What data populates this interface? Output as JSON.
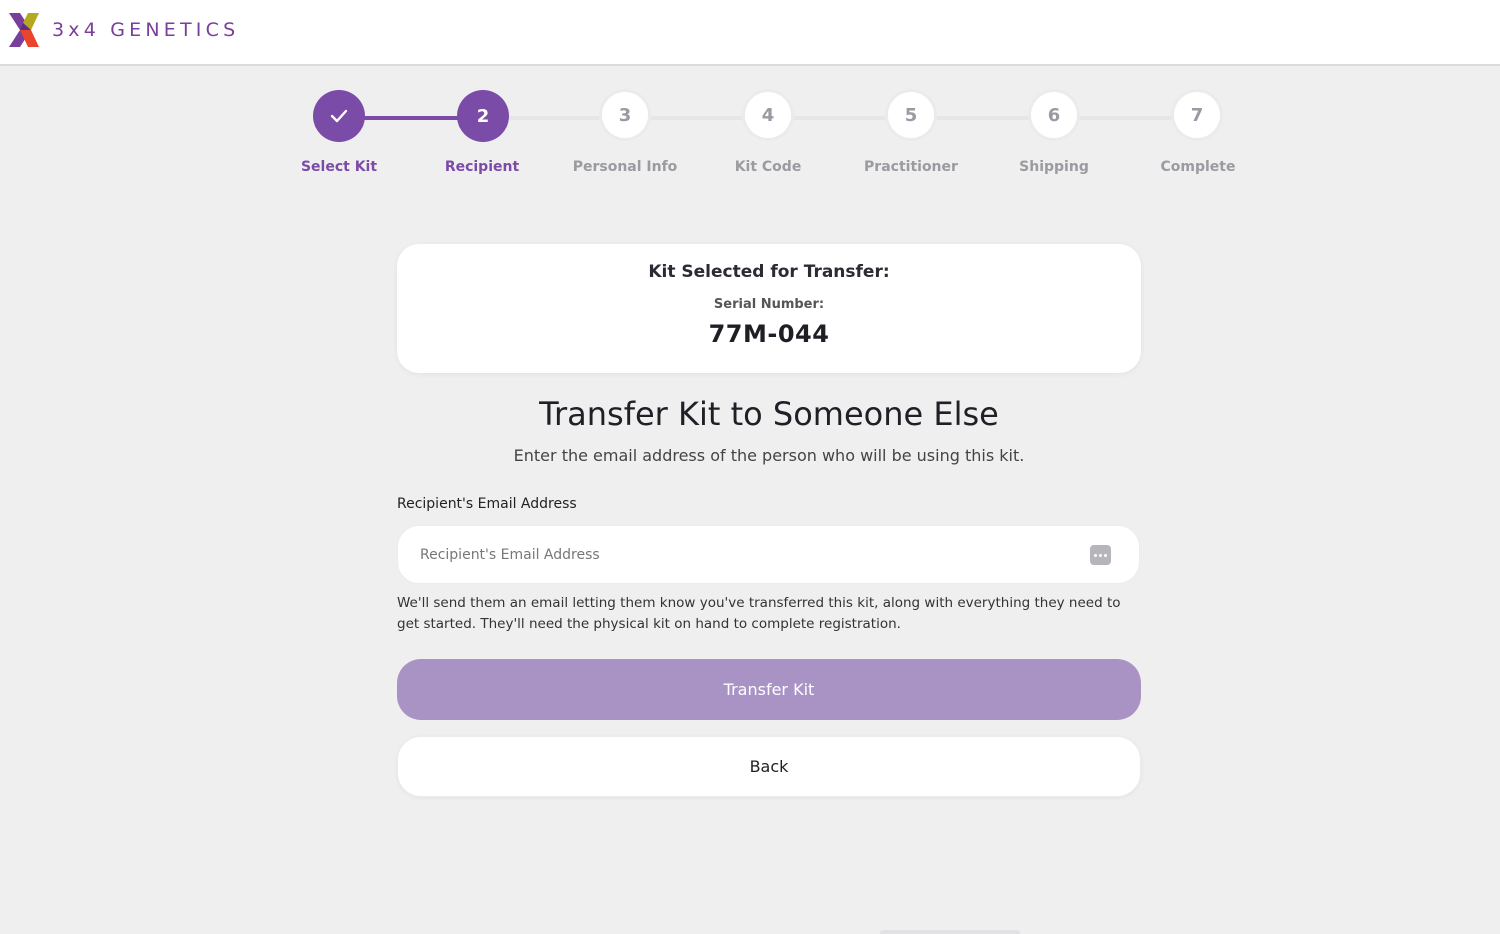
{
  "brand": {
    "name": "3x4 GENETICS",
    "colors": {
      "primary": "#7b4ba8",
      "button_disabled": "#a993c4",
      "logo_purple": "#7a3f9a",
      "logo_orange": "#e8452c",
      "logo_olive": "#b5a81e"
    }
  },
  "stepper": {
    "steps": [
      {
        "number": "✓",
        "label": "Select Kit",
        "state": "completed"
      },
      {
        "number": "2",
        "label": "Recipient",
        "state": "current"
      },
      {
        "number": "3",
        "label": "Personal Info",
        "state": "pending"
      },
      {
        "number": "4",
        "label": "Kit Code",
        "state": "pending"
      },
      {
        "number": "5",
        "label": "Practitioner",
        "state": "pending"
      },
      {
        "number": "6",
        "label": "Shipping",
        "state": "pending"
      },
      {
        "number": "7",
        "label": "Complete",
        "state": "pending"
      }
    ]
  },
  "kit_card": {
    "title": "Kit Selected for Transfer:",
    "serial_label": "Serial Number:",
    "serial_value": "77M-044"
  },
  "main": {
    "headline": "Transfer Kit to Someone Else",
    "subline": "Enter the email address of the person who will be using this kit.",
    "email_label": "Recipient's Email Address",
    "email_placeholder": "Recipient's Email Address",
    "email_value": "",
    "help_text": "We'll send them an email letting them know you've transferred this kit, along with everything they need to get started. They'll need the physical kit on hand to complete registration.",
    "transfer_button": "Transfer Kit",
    "back_button": "Back"
  }
}
